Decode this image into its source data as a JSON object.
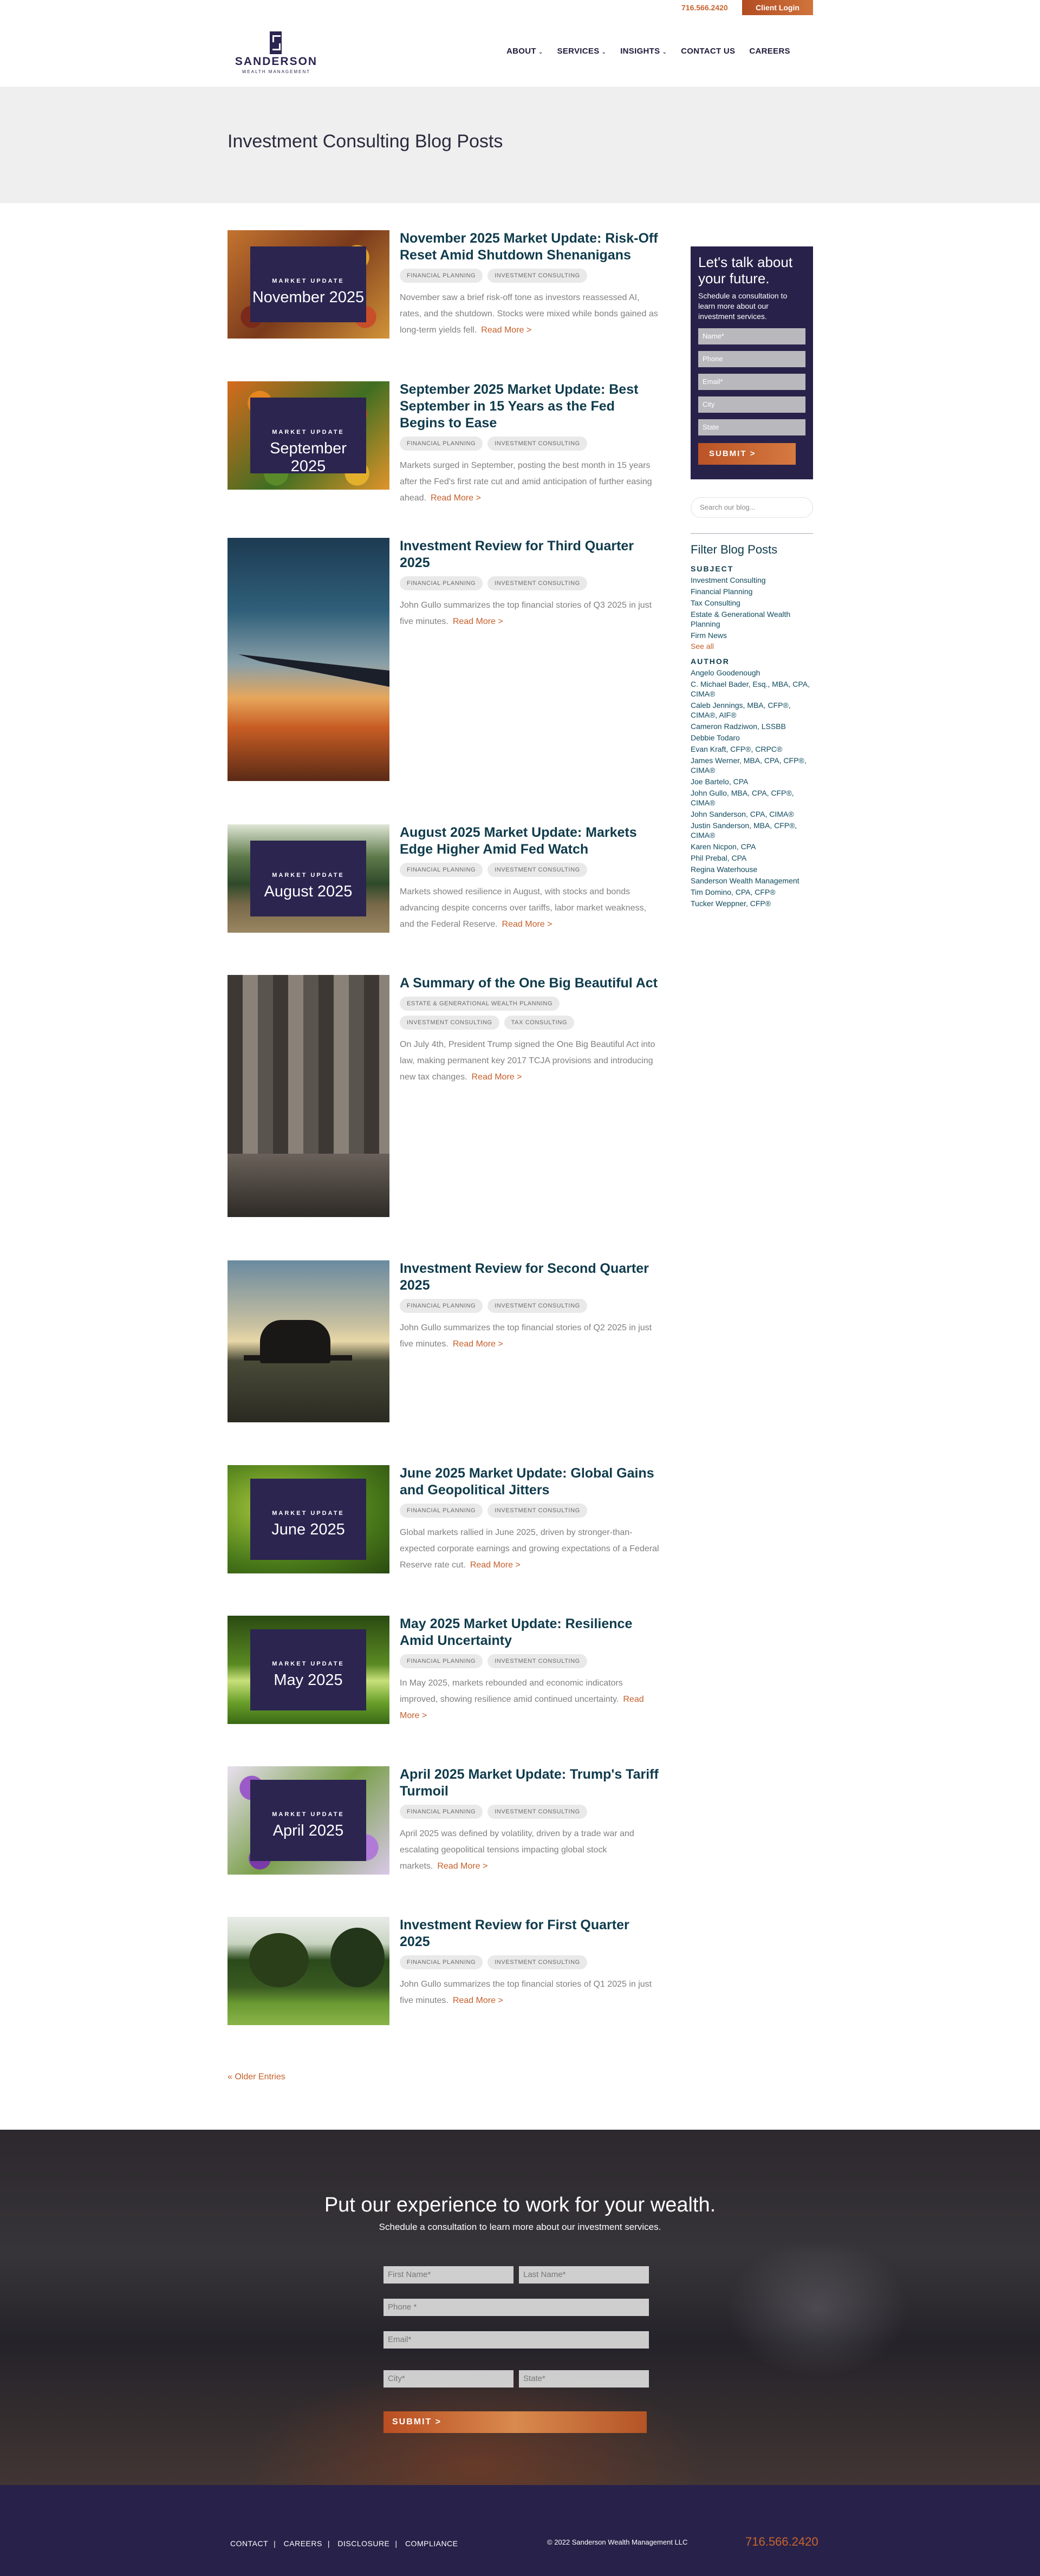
{
  "topbar": {
    "phone": "716.566.2420",
    "client_login": "Client Login"
  },
  "header": {
    "logo_name": "SANDERSON",
    "logo_sub": "WEALTH MANAGEMENT",
    "nav": [
      {
        "label": "ABOUT",
        "has_dropdown": true
      },
      {
        "label": "SERVICES",
        "has_dropdown": true
      },
      {
        "label": "INSIGHTS",
        "has_dropdown": true
      },
      {
        "label": "CONTACT US",
        "has_dropdown": false
      },
      {
        "label": "CAREERS",
        "has_dropdown": false
      }
    ]
  },
  "hero": {
    "title": "Investment Consulting Blog Posts"
  },
  "posts": [
    {
      "title": "November 2025 Market Update: Risk-Off Reset Amid Shutdown Shenanigans",
      "tags": [
        "FINANCIAL PLANNING",
        "INVESTMENT CONSULTING"
      ],
      "excerpt": "November saw a brief risk-off tone as investors reassessed AI, rates, and the shutdown. Stocks were mixed while bonds gained as long-term yields fell.",
      "read_more": "Read More >",
      "badge_top": "MARKET UPDATE",
      "badge_month": "November 2025"
    },
    {
      "title": "September 2025 Market Update: Best September in 15 Years as the Fed Begins to Ease",
      "tags": [
        "FINANCIAL PLANNING",
        "INVESTMENT CONSULTING"
      ],
      "excerpt": "Markets surged in September, posting the best month in 15 years after the Fed's first rate cut and amid anticipation of further easing ahead.",
      "read_more": "Read More >",
      "badge_top": "MARKET UPDATE",
      "badge_month": "September 2025"
    },
    {
      "title": "Investment Review for Third Quarter 2025",
      "tags": [
        "FINANCIAL PLANNING",
        "INVESTMENT CONSULTING"
      ],
      "excerpt": "John Gullo summarizes the top financial stories of Q3 2025 in just five minutes.",
      "read_more": "Read More >"
    },
    {
      "title": "August 2025 Market Update: Markets Edge Higher Amid Fed Watch",
      "tags": [
        "FINANCIAL PLANNING",
        "INVESTMENT CONSULTING"
      ],
      "excerpt": "Markets showed resilience in August, with stocks and bonds advancing despite concerns over tariffs, labor market weakness, and the Federal Reserve.",
      "read_more": "Read More >",
      "badge_top": "MARKET UPDATE",
      "badge_month": "August 2025"
    },
    {
      "title": "A Summary of the One Big Beautiful Act",
      "tags": [
        "ESTATE & GENERATIONAL WEALTH PLANNING",
        "INVESTMENT CONSULTING",
        "TAX CONSULTING"
      ],
      "excerpt": "On July 4th, President Trump signed the One Big Beautiful Act into law, making permanent key 2017 TCJA provisions and introducing new tax changes.",
      "read_more": "Read More >"
    },
    {
      "title": "Investment Review for Second Quarter 2025",
      "tags": [
        "FINANCIAL PLANNING",
        "INVESTMENT CONSULTING"
      ],
      "excerpt": "John Gullo summarizes the top financial stories of Q2 2025 in just five minutes.",
      "read_more": "Read More >"
    },
    {
      "title": "June 2025 Market Update: Global Gains and Geopolitical Jitters",
      "tags": [
        "FINANCIAL PLANNING",
        "INVESTMENT CONSULTING"
      ],
      "excerpt": "Global markets rallied in June 2025, driven by stronger-than-expected corporate earnings and growing expectations of a Federal Reserve rate cut.",
      "read_more": "Read More >",
      "badge_top": "MARKET UPDATE",
      "badge_month": "June 2025"
    },
    {
      "title": "May 2025 Market Update: Resilience Amid Uncertainty",
      "tags": [
        "FINANCIAL PLANNING",
        "INVESTMENT CONSULTING"
      ],
      "excerpt": "In May 2025, markets rebounded and economic indicators improved, showing resilience amid continued uncertainty.",
      "read_more": "Read More >",
      "badge_top": "MARKET UPDATE",
      "badge_month": "May 2025"
    },
    {
      "title": "April 2025 Market Update: Trump's Tariff Turmoil",
      "tags": [
        "FINANCIAL PLANNING",
        "INVESTMENT CONSULTING"
      ],
      "excerpt": "April 2025 was defined by volatility, driven by a trade war and escalating geopolitical tensions impacting global stock markets.",
      "read_more": "Read More >",
      "badge_top": "MARKET UPDATE",
      "badge_month": "April 2025"
    },
    {
      "title": "Investment Review for First Quarter 2025",
      "tags": [
        "FINANCIAL PLANNING",
        "INVESTMENT CONSULTING"
      ],
      "excerpt": "John Gullo summarizes the top financial stories of Q1 2025 in just five minutes.",
      "read_more": "Read More >"
    }
  ],
  "older_entries": "« Older Entries",
  "sidebar": {
    "consult_title": "Let's talk about your future.",
    "consult_text": "Schedule a consultation to learn more about our investment services.",
    "fields": [
      "Name*",
      "Phone",
      "Email*",
      "City",
      "State"
    ],
    "submit": "SUBMIT >",
    "search_placeholder": "Search our blog...",
    "filter_title": "Filter Blog Posts",
    "subject_heading": "SUBJECT",
    "subjects": [
      "Investment Consulting",
      "Financial Planning",
      "Tax Consulting",
      "Estate & Generational Wealth Planning",
      "Firm News"
    ],
    "see_all": "See all",
    "author_heading": "AUTHOR",
    "authors": [
      "Angelo Goodenough",
      "C. Michael Bader, Esq., MBA, CPA, CIMA®",
      "Caleb Jennings, MBA, CFP®, CIMA®, AIF®",
      "Cameron Radziwon, LSSBB",
      "Debbie Todaro",
      "Evan Kraft, CFP®, CRPC®",
      "James Werner, MBA, CPA, CFP®, CIMA®",
      "Joe Bartelo, CPA",
      "John Gullo, MBA, CPA, CFP®, CIMA®",
      "John Sanderson, CPA, CIMA®",
      "Justin Sanderson, MBA, CFP®, CIMA®",
      "Karen Nicpon, CPA",
      "Phil Prebal, CPA",
      "Regina Waterhouse",
      "Sanderson Wealth Management",
      "Tim Domino, CPA, CFP®",
      "Tucker Weppner, CFP®"
    ]
  },
  "cta": {
    "title": "Put our experience to work for your wealth.",
    "subtitle": "Schedule a consultation to learn more about our investment services.",
    "first_name": "First Name*",
    "last_name": "Last Name*",
    "phone": "Phone *",
    "email": "Email*",
    "city": "City*",
    "state": "State*",
    "submit": "SUBMIT >"
  },
  "footer": {
    "links": [
      "CONTACT",
      "CAREERS",
      "DISCLOSURE",
      "COMPLIANCE"
    ],
    "copyright": "© 2022 Sanderson Wealth Management LLC",
    "phone": "716.566.2420"
  }
}
